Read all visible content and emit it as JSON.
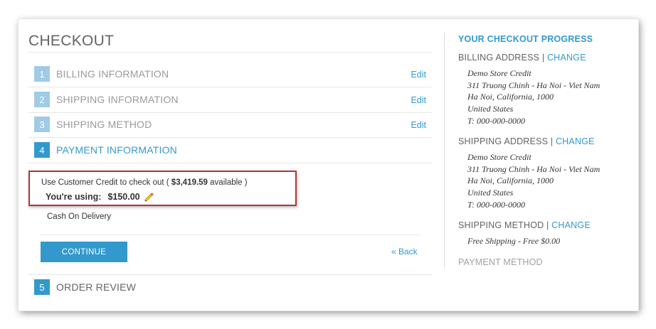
{
  "checkout": {
    "title": "CHECKOUT",
    "steps": [
      {
        "num": "1",
        "label": "BILLING INFORMATION",
        "edit": "Edit"
      },
      {
        "num": "2",
        "label": "SHIPPING INFORMATION",
        "edit": "Edit"
      },
      {
        "num": "3",
        "label": "SHIPPING METHOD",
        "edit": "Edit"
      },
      {
        "num": "4",
        "label": "PAYMENT INFORMATION"
      },
      {
        "num": "5",
        "label": "ORDER REVIEW"
      }
    ],
    "payment": {
      "credit_prefix": "Use Customer Credit to check out ( ",
      "credit_available": "$3,419.59",
      "credit_suffix": " available )",
      "using_label": "You're using:",
      "using_amount": "$150.00",
      "cod_label": "Cash On Delivery",
      "continue_label": "CONTINUE",
      "back_label": "« Back"
    }
  },
  "progress": {
    "title": "YOUR CHECKOUT PROGRESS",
    "separator": " | ",
    "change_label": "CHANGE",
    "billing": {
      "heading": "BILLING ADDRESS",
      "lines": [
        "Demo Store Credit",
        "311 Truong Chinh - Ha Noi - Viet Nam",
        "Ha Noi, California, 1000",
        "United States",
        "T: 000-000-0000"
      ]
    },
    "shipping": {
      "heading": "SHIPPING ADDRESS",
      "lines": [
        "Demo Store Credit",
        "311 Truong Chinh - Ha Noi - Viet Nam",
        "Ha Noi, California, 1000",
        "United States",
        "T: 000-000-0000"
      ]
    },
    "shipping_method": {
      "heading": "SHIPPING METHOD",
      "value": "Free Shipping - Free $0.00"
    },
    "payment_method": {
      "heading": "PAYMENT METHOD"
    }
  },
  "colors": {
    "accent": "#3399cc",
    "accent_light": "#9fcbe6",
    "highlight_border": "#b83232",
    "text": "#333333",
    "muted": "#9a9a9a"
  },
  "icons": {
    "edit_amount": "pencil-icon"
  }
}
